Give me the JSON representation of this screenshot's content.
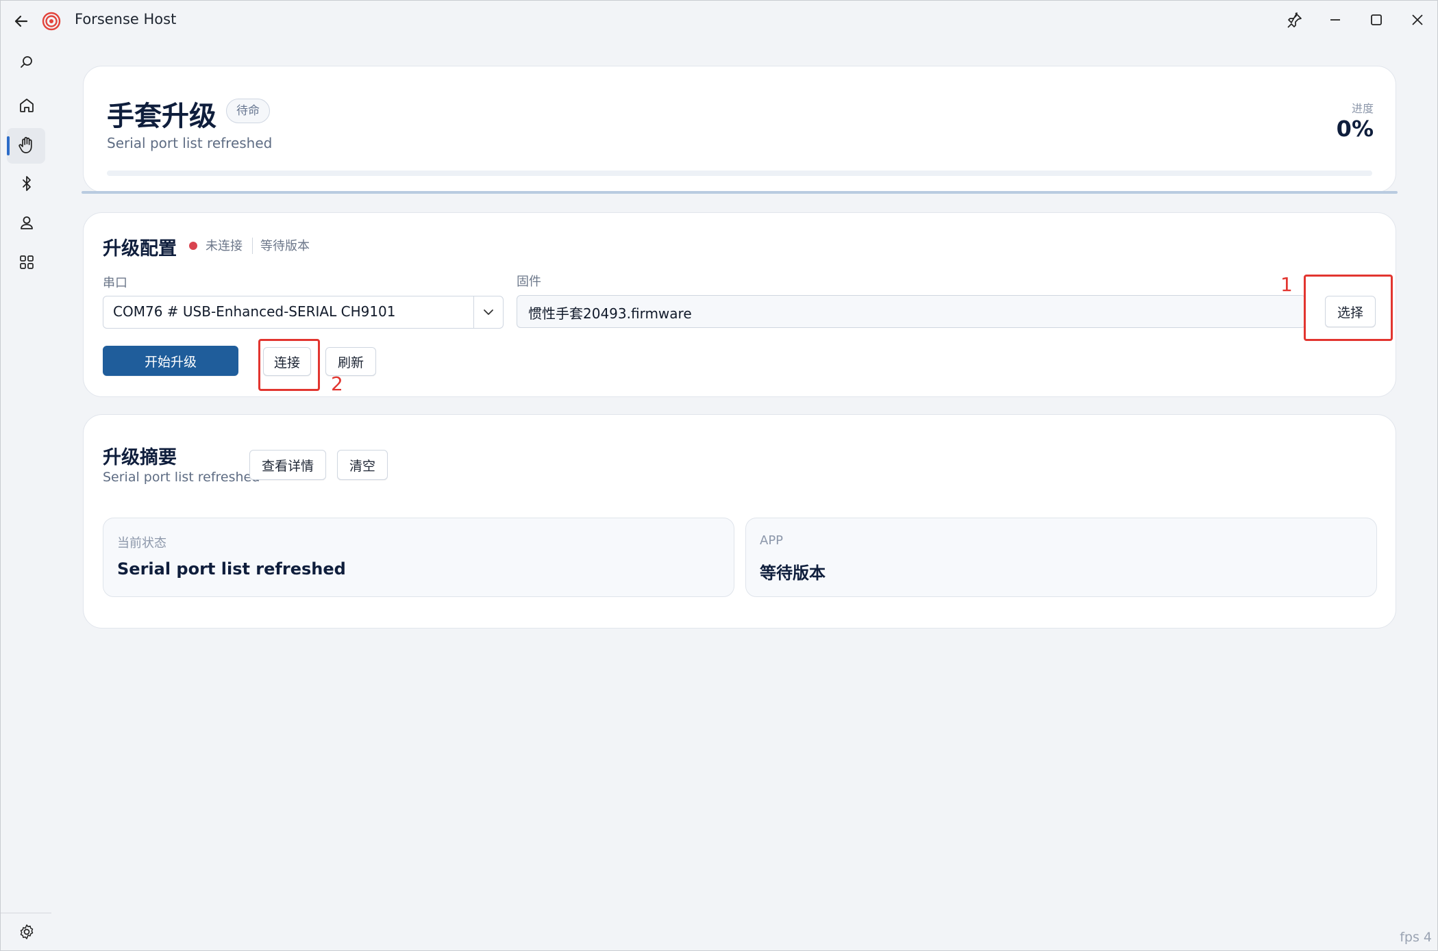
{
  "window": {
    "title": "Forsense Host"
  },
  "header": {
    "title": "手套升级",
    "status_pill": "待命",
    "subtitle": "Serial port list refreshed",
    "progress_label": "进度",
    "progress_value": "0%",
    "progress_fraction": 0
  },
  "config": {
    "title": "升级配置",
    "connection_status": "未连接",
    "version_status": "等待版本",
    "serial_label": "串口",
    "serial_value": "COM76 # USB-Enhanced-SERIAL CH9101",
    "firmware_label": "固件",
    "firmware_value": "惯性手套20493.firmware",
    "select_button": "选择",
    "start_button": "开始升级",
    "connect_button": "连接",
    "refresh_button": "刷新",
    "annotation_1": "1",
    "annotation_2": "2"
  },
  "summary": {
    "title": "升级摘要",
    "subtitle": "Serial port list refreshed",
    "details_button": "查看详情",
    "clear_button": "清空",
    "current_status_label": "当前状态",
    "current_status_value": "Serial port list refreshed",
    "app_label": "APP",
    "app_value": "等待版本"
  },
  "footer": {
    "fps": "fps 4"
  },
  "colors": {
    "accent": "#1f5d9b",
    "annotation": "#e2352f",
    "disconnected": "#d9434f"
  }
}
